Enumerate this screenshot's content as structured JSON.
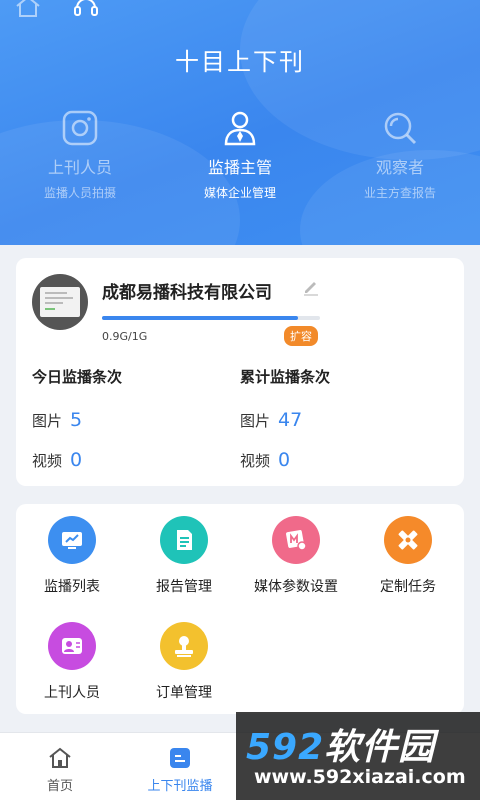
{
  "header": {
    "title": "十目上下刊",
    "top_icons": [
      "home-icon",
      "headset-icon"
    ]
  },
  "roles": [
    {
      "name": "上刊人员",
      "sub": "监播人员拍摄",
      "icon": "instagram-camera-icon",
      "active": false
    },
    {
      "name": "监播主管",
      "sub": "媒体企业管理",
      "icon": "user-tie-icon",
      "active": true
    },
    {
      "name": "观察者",
      "sub": "业主方查报告",
      "icon": "search-icon",
      "active": false
    }
  ],
  "account": {
    "company": "成都易播科技有限公司",
    "storage_text": "0.9G/1G",
    "storage_used_fraction": 0.9,
    "expand_label": "扩容"
  },
  "stats": {
    "today": {
      "title": "今日监播条次",
      "image_label": "图片",
      "image_value": "5",
      "video_label": "视频",
      "video_value": "0"
    },
    "total": {
      "title": "累计监播条次",
      "image_label": "图片",
      "image_value": "47",
      "video_label": "视频",
      "video_value": "0"
    }
  },
  "menu": [
    {
      "label": "监播列表",
      "icon": "monitor-chart-icon",
      "color": "#3d8ff0"
    },
    {
      "label": "报告管理",
      "icon": "report-doc-icon",
      "color": "#1fc3b8"
    },
    {
      "label": "媒体参数设置",
      "icon": "media-settings-icon",
      "color": "#f06a8a"
    },
    {
      "label": "定制任务",
      "icon": "custom-task-icon",
      "color": "#f58a2a"
    },
    {
      "label": "上刊人员",
      "icon": "staff-card-icon",
      "color": "#c74ce0"
    },
    {
      "label": "订单管理",
      "icon": "order-stamp-icon",
      "color": "#f3c12e"
    }
  ],
  "tabbar": [
    {
      "label": "首页",
      "icon": "home-icon",
      "active": false
    },
    {
      "label": "上下刊监播",
      "icon": "monitor-tab-icon",
      "active": true
    }
  ],
  "watermark": {
    "brand_num": "592",
    "brand_text": "软件园",
    "url": "www.592xiazai.com"
  },
  "colors": {
    "primary": "#3a86ee",
    "accent_orange": "#f28a2a"
  }
}
